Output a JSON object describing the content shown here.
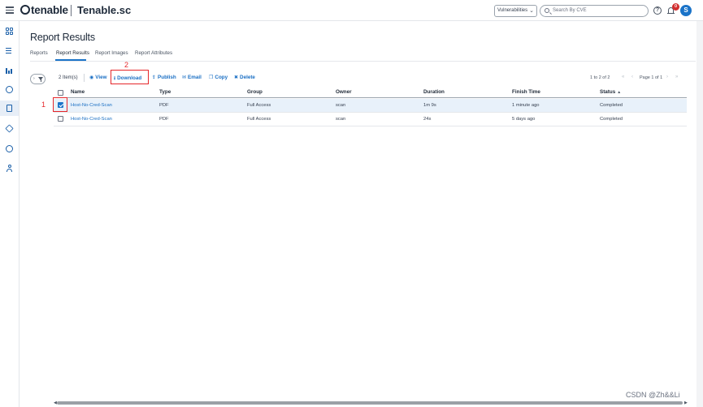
{
  "app": {
    "brand": "tenable",
    "product": "Tenable.sc"
  },
  "header": {
    "context_select": "Vulnerabilities",
    "search_placeholder": "Search By CVE",
    "help_glyph": "?",
    "notifications_count": "0",
    "avatar_initial": "S"
  },
  "sidebar": {
    "items": [
      {
        "icon": "dashboard-icon"
      },
      {
        "icon": "list-icon"
      },
      {
        "icon": "analysis-icon"
      },
      {
        "icon": "scan-icon"
      },
      {
        "icon": "reports-icon",
        "active": true
      },
      {
        "icon": "assets-icon"
      },
      {
        "icon": "repositories-icon"
      },
      {
        "icon": "users-icon"
      }
    ]
  },
  "page": {
    "title": "Report Results",
    "tabs": [
      "Reports",
      "Report Results",
      "Report Images",
      "Report Attributes"
    ],
    "active_tab": "Report Results"
  },
  "toolbar": {
    "filter_toggle": "›",
    "item_count": "2 Item(s)",
    "actions": [
      {
        "label": "View",
        "icon": "eye-icon",
        "glyph": "◉"
      },
      {
        "label": "Download",
        "icon": "download-icon",
        "glyph": "⭳"
      },
      {
        "label": "Publish",
        "icon": "publish-icon",
        "glyph": "⇪"
      },
      {
        "label": "Email",
        "icon": "email-icon",
        "glyph": "✉"
      },
      {
        "label": "Copy",
        "icon": "copy-icon",
        "glyph": "❐"
      },
      {
        "label": "Delete",
        "icon": "delete-icon",
        "glyph": "✖"
      }
    ],
    "pager_range": "1 to 2 of 2",
    "pager_page": "Page 1 of 1"
  },
  "annotations": {
    "step1": "1",
    "step2": "2"
  },
  "table": {
    "columns": [
      "Name",
      "Type",
      "Group",
      "Owner",
      "Duration",
      "Finish Time",
      "Status"
    ],
    "sorted_column": "Status",
    "rows": [
      {
        "selected": true,
        "name": "Host-No-Cred-Scan",
        "type": "PDF",
        "group": "Full Access",
        "owner": "scan",
        "duration": "1m 9s",
        "finish_time": "1 minute ago",
        "status": "Completed"
      },
      {
        "selected": false,
        "name": "Host-No-Cred-Scan",
        "type": "PDF",
        "group": "Full Access",
        "owner": "scan",
        "duration": "24s",
        "finish_time": "5 days ago",
        "status": "Completed"
      }
    ]
  },
  "watermark": "CSDN @Zh&&Li",
  "colors": {
    "accent": "#1a73c8",
    "link": "#1a6fc4",
    "highlight": "#e5262a",
    "selected_row": "#e8f1fa",
    "badge": "#d32f2f"
  }
}
